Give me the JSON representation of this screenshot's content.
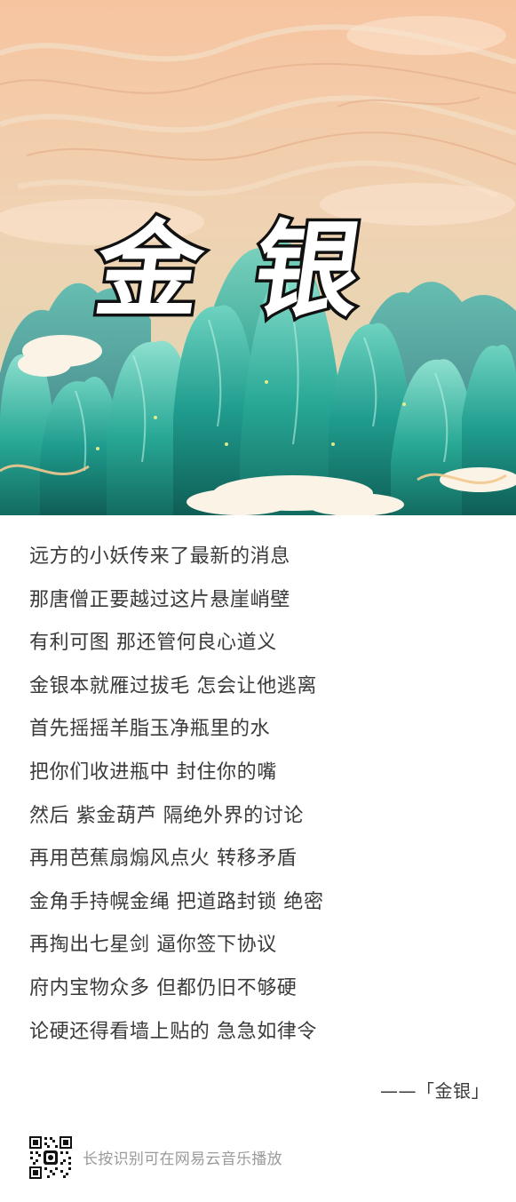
{
  "title": "金银",
  "lyrics": [
    "远方的小妖传来了最新的消息",
    "那唐僧正要越过这片悬崖峭壁",
    "有利可图 那还管何良心道义",
    "金银本就雁过拔毛 怎会让他逃离",
    "首先摇摇羊脂玉净瓶里的水",
    "把你们收进瓶中 封住你的嘴",
    "然后 紫金葫芦 隔绝外界的讨论",
    "再用芭蕉扇煽风点火 转移矛盾",
    "金角手持幌金绳 把道路封锁 绝密",
    "再掏出七星剑 逼你签下协议",
    "府内宝物众多 但都仍旧不够硬",
    "论硬还得看墙上贴的 急急如律令"
  ],
  "signature": "——「金银」",
  "footer": {
    "qr_icon": "qr-code-icon",
    "caption": "长按识别可在网易云音乐播放"
  },
  "colors": {
    "sky_top": "#f6c8a4",
    "sky_bottom": "#e8d9b8",
    "mountain_teal": "#1f9c8e",
    "mountain_dark": "#137363",
    "text": "#3a3a3a",
    "caption": "#9a9a9a"
  }
}
